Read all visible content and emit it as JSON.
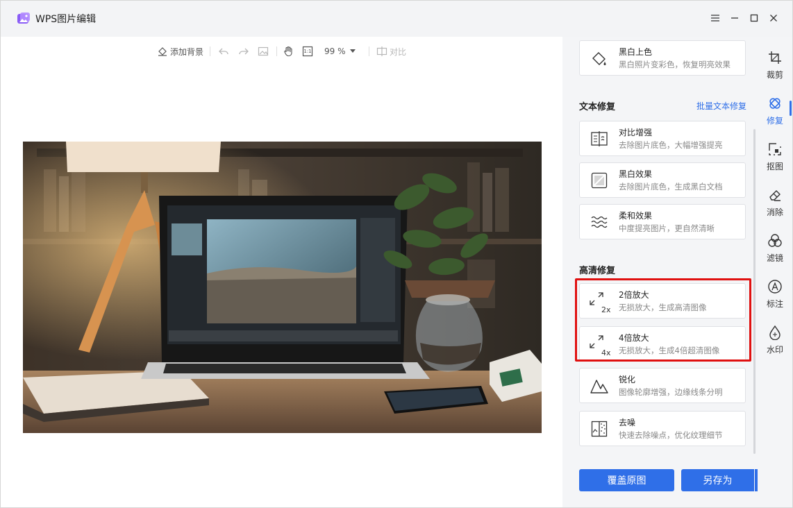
{
  "app": {
    "title": "WPS图片编辑"
  },
  "toolbar": {
    "add_background": "添加背景",
    "zoom_value": "99 %",
    "compare": "对比",
    "ratio_label": "1:1"
  },
  "panel": {
    "top_card": {
      "title": "黑白上色",
      "desc": "黑白照片变彩色，恢复明亮效果"
    },
    "text_repair": {
      "heading": "文本修复",
      "batch_link": "批量文本修复",
      "items": [
        {
          "title": "对比增强",
          "desc": "去除图片底色，大幅增强提亮"
        },
        {
          "title": "黑白效果",
          "desc": "去除图片底色，生成黑白文档"
        },
        {
          "title": "柔和效果",
          "desc": "中度提亮图片，更自然清晰"
        }
      ]
    },
    "hd_repair": {
      "heading": "高清修复",
      "items": [
        {
          "title": "2倍放大",
          "desc": "无损放大，生成高清图像",
          "badge": "2x"
        },
        {
          "title": "4倍放大",
          "desc": "无损放大，生成4倍超清图像",
          "badge": "4x"
        },
        {
          "title": "锐化",
          "desc": "图像轮廓增强，边缘线条分明"
        },
        {
          "title": "去噪",
          "desc": "快速去除噪点，优化纹理细节"
        }
      ]
    },
    "buttons": {
      "overwrite": "覆盖原图",
      "save_as": "另存为"
    }
  },
  "rail": {
    "items": [
      {
        "label": "裁剪",
        "icon": "crop-icon"
      },
      {
        "label": "修复",
        "icon": "repair-icon",
        "active": true
      },
      {
        "label": "抠图",
        "icon": "cutout-icon"
      },
      {
        "label": "消除",
        "icon": "eraser-icon"
      },
      {
        "label": "滤镜",
        "icon": "filter-icon"
      },
      {
        "label": "标注",
        "icon": "annotate-icon"
      },
      {
        "label": "水印",
        "icon": "watermark-icon"
      }
    ]
  },
  "colors": {
    "accent": "#2f6fe8",
    "highlight": "#e01010",
    "panel_bg": "#f4f5f7"
  }
}
